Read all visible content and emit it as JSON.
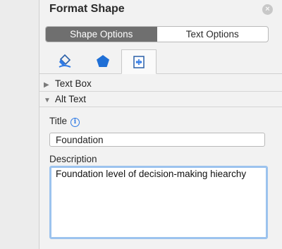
{
  "panel": {
    "title": "Format Shape",
    "close_icon": "close-circle-icon"
  },
  "segmented": {
    "shape_options": "Shape Options",
    "text_options": "Text Options",
    "selected": "Shape Options"
  },
  "icon_tabs": [
    {
      "name": "fill-bucket-icon"
    },
    {
      "name": "pentagon-effects-icon"
    },
    {
      "name": "size-properties-icon",
      "selected": true
    }
  ],
  "sections": {
    "text_box": "Text Box",
    "alt_text": "Alt Text"
  },
  "alt_text": {
    "title_label": "Title",
    "title_info_glyph": "i",
    "title_value": "Foundation",
    "description_label": "Description",
    "description_value": "Foundation level of decision-making hiearchy"
  },
  "colors": {
    "accent": "#2f7ae5",
    "focus_ring": "#9cc3ee",
    "segment_active": "#6f6f6f"
  }
}
